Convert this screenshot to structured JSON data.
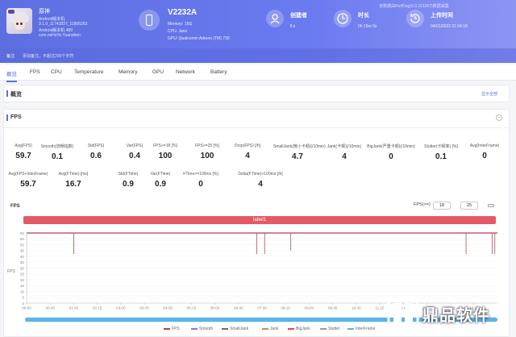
{
  "colors": {
    "accent": "#5d6fe0",
    "fps_line": "#b23a63",
    "label_bar": "#e35a66",
    "scroll": "#59b4e8"
  },
  "header": {
    "user": {
      "name": "原神",
      "lines": [
        "Android版本机",
        "3.1.0_11741827_11806263",
        "Android版本机 489",
        "com.miHoYo.Yuanshen"
      ]
    },
    "device": {
      "title": "V2232A",
      "lines": [
        "Memory: 15G",
        "CPU: Janx",
        "GPU: Qualcomm Adreno (TM) 730"
      ]
    },
    "stats": [
      {
        "label": "创建者",
        "value": "ll.k",
        "icon": "user-icon"
      },
      {
        "label": "时长",
        "value": "0h 15m 0s",
        "icon": "clock-icon"
      },
      {
        "label": "上传时间",
        "value": "04/01/2023 21:04:18",
        "icon": "history-icon"
      }
    ],
    "hint": "该数据由PerfDog(5.0.221057)数据采集",
    "note_label": "备注",
    "note_text": "添加备注，不超过200个字符"
  },
  "tabs": [
    "概览",
    "FPS",
    "CPU",
    "Temperature",
    "Memory",
    "GPU",
    "Network",
    "Battery"
  ],
  "overview": {
    "title": "概览",
    "expand": "显示全部"
  },
  "fps": {
    "title": "FPS",
    "metrics_row1": [
      {
        "label": "Avg(FPS)",
        "value": "59.7"
      },
      {
        "label": "Smooth(流畅指数)",
        "value": "0.1"
      },
      {
        "label": "Std(FPS)",
        "value": "0.6"
      },
      {
        "label": "Var(FPS)",
        "value": "0.4"
      },
      {
        "label": "FPS>=18 [%]",
        "value": "100"
      },
      {
        "label": "FPS>=25 [%]",
        "value": "100"
      },
      {
        "label": "Drop(FPS) [/h]",
        "value": "4"
      },
      {
        "label": "SmallJank(微小卡顿)(/10min)",
        "value": "4.7"
      },
      {
        "label": "Jank(卡顿)(/10min)",
        "value": "4"
      },
      {
        "label": "BigJank(严重卡顿)(/10min)",
        "value": "0"
      },
      {
        "label": "Stutter(卡顿率) [%]",
        "value": "0.1"
      },
      {
        "label": "Avg(InterFrame)",
        "value": "0"
      }
    ],
    "metrics_row2": [
      {
        "label": "Avg(FPS+InterFrame)",
        "value": "59.7"
      },
      {
        "label": "Avg(FTime) [ms]",
        "value": "16.7"
      },
      {
        "label": "Std(FTime)",
        "value": "0.9"
      },
      {
        "label": "Var(FTime)",
        "value": "0.9"
      },
      {
        "label": "FTime>=100ms [%]",
        "value": "0"
      },
      {
        "label": "Delta(FTime)>100ms [/h]",
        "value": "4"
      }
    ],
    "chart_label": "FPS",
    "filter_label": "FPS(>=)",
    "filter_values": [
      "18",
      "25"
    ],
    "label_bar_text": "label1",
    "y_axis_title": "FPS",
    "legend": [
      {
        "name": "FPS",
        "color": "#b23a63"
      },
      {
        "name": "Smooth",
        "color": "#7a7ad8"
      },
      {
        "name": "SmallJank",
        "color": "#6b6b6b"
      },
      {
        "name": "Jank",
        "color": "#c98a4f"
      },
      {
        "name": "BigJank",
        "color": "#e0485a"
      },
      {
        "name": "Stutter",
        "color": "#999999"
      },
      {
        "name": "InterFrame",
        "color": "#59b4e8"
      }
    ]
  },
  "chart_data": {
    "type": "line",
    "ylim": [
      0,
      60
    ],
    "y_ticks": [
      "60",
      "55",
      "50",
      "45",
      "40",
      "35",
      "30",
      "25",
      "20",
      "15",
      "10",
      "5",
      "0"
    ],
    "x_ticks": [
      "00:00",
      "00:45",
      "01:30",
      "02:15",
      "03:00",
      "03:45",
      "04:30",
      "05:15",
      "06:00",
      "06:45",
      "07:30",
      "08:15",
      "09:00",
      "09:45",
      "10:30",
      "11:15",
      "12:00",
      "12:45",
      "13:30",
      "14:15"
    ],
    "series": [
      {
        "name": "FPS",
        "type": "line",
        "values": [
          60,
          60,
          60,
          60,
          60,
          60,
          60,
          60,
          60,
          60,
          60,
          60,
          60,
          60,
          60,
          60,
          60,
          60,
          60,
          60
        ]
      },
      {
        "name": "Jank",
        "type": "spikes",
        "t_seconds": [
          90,
          440,
          455,
          505,
          840,
          890,
          895
        ],
        "values": [
          18,
          18,
          18,
          15,
          18,
          18,
          18
        ]
      }
    ]
  },
  "logo": {
    "text": "鼎品软件"
  }
}
